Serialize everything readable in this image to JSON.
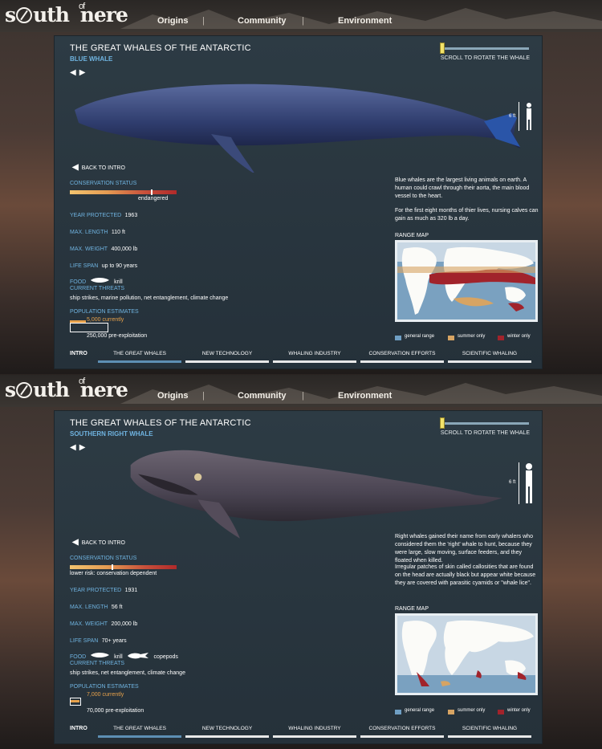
{
  "site": {
    "logo_text_1": "s",
    "logo_text_2": "uth",
    "logo_of": "of",
    "logo_text_3": "nere"
  },
  "nav": {
    "items": [
      "Origins",
      "Community",
      "Environment"
    ]
  },
  "colors": {
    "accent": "#6fb3e0",
    "tab_active": "#5d8fb4",
    "population_current": "#e6a14b",
    "general_range": "#6f9fc4",
    "summer_only": "#d7a463",
    "winter_only": "#a1232b"
  },
  "screens": [
    {
      "title": "THE GREAT WHALES OF THE ANTARCTIC",
      "subtitle": "BLUE WHALE",
      "scroll_label": "SCROLL TO ROTATE THE WHALE",
      "scale_label": "6 ft",
      "back_label": "BACK TO INTRO",
      "conservation_label": "CONSERVATION STATUS",
      "conservation_value": "endangered",
      "conservation_level": 0.76,
      "year_label": "YEAR PROTECTED",
      "year_value": "1963",
      "length_label": "MAX. LENGTH",
      "length_value": "110 ft",
      "weight_label": "MAX. WEIGHT",
      "weight_value": "400,000 lb",
      "life_label": "LIFE SPAN",
      "life_value": "up to 90 years",
      "food_label": "FOOD",
      "food_items": [
        "krill"
      ],
      "threats_label": "CURRENT THREATS",
      "threats_value": "ship strikes, marine pollution, net entanglement, climate change",
      "pop_label": "POPULATION ESTIMATES",
      "pop_current": "5,000 currently",
      "pop_pre": "250,000 pre-exploitation",
      "desc_1": "Blue whales are the largest living animals on earth. A human could crawl through their aorta, the main blood vessel to the heart.",
      "desc_2": "For the first eight months of thier lives, nursing calves can gain as much as 320 lb a day.",
      "range_label": "RANGE MAP",
      "legend": [
        "general range",
        "summer only",
        "winter only"
      ],
      "tabs": {
        "intro": "INTRO",
        "items": [
          "THE GREAT WHALES",
          "NEW TECHNOLOGY",
          "WHALING INDUSTRY",
          "CONSERVATION EFFORTS",
          "SCIENTIFIC WHALING"
        ]
      }
    },
    {
      "title": "THE GREAT WHALES OF THE ANTARCTIC",
      "subtitle": "SOUTHERN RIGHT WHALE",
      "scroll_label": "SCROLL TO ROTATE THE WHALE",
      "scale_label": "6 ft",
      "back_label": "BACK TO INTRO",
      "conservation_label": "CONSERVATION STATUS",
      "conservation_value": "lower risk: conservation dependent",
      "conservation_level": 0.4,
      "year_label": "YEAR PROTECTED",
      "year_value": "1931",
      "length_label": "MAX. LENGTH",
      "length_value": "56 ft",
      "weight_label": "MAX. WEIGHT",
      "weight_value": "200,000 lb",
      "life_label": "LIFE SPAN",
      "life_value": "70+ years",
      "food_label": "FOOD",
      "food_items": [
        "krill",
        "copepods"
      ],
      "threats_label": "CURRENT THREATS",
      "threats_value": "ship strikes, net entanglement, climate change",
      "pop_label": "POPULATION ESTIMATES",
      "pop_current": "7,000 currently",
      "pop_pre": "70,000 pre-exploitation",
      "desc_1": "Right whales gained their name from early whalers who considered them the 'right' whale to hunt, because they were large, slow moving, surface feeders, and they floated when killed.",
      "desc_2": "Irregular patches of skin called callosities that are found on the head are actually black but appear white because they are covered with parasitic cyamids or \"whale lice\".",
      "range_label": "RANGE MAP",
      "legend": [
        "general range",
        "summer only",
        "winter only"
      ],
      "tabs": {
        "intro": "INTRO",
        "items": [
          "THE GREAT WHALES",
          "NEW TECHNOLOGY",
          "WHALING INDUSTRY",
          "CONSERVATION EFFORTS",
          "SCIENTIFIC WHALING"
        ]
      }
    }
  ]
}
